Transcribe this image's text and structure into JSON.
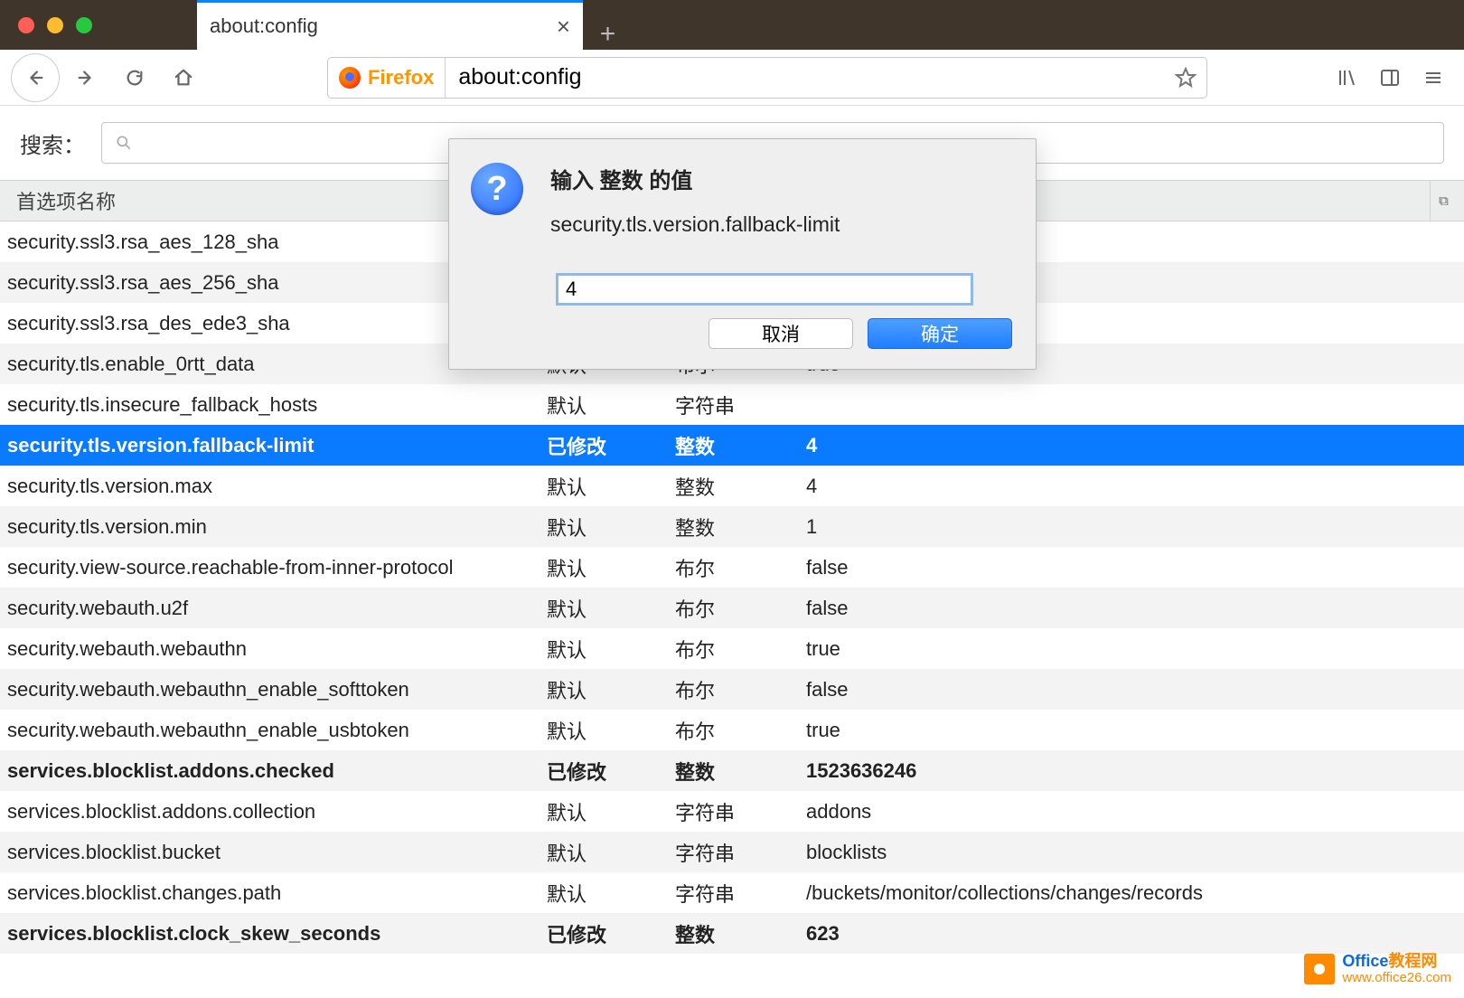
{
  "titlebar": {
    "tab_title": "about:config"
  },
  "toolbar": {
    "identity_label": "Firefox",
    "url": "about:config"
  },
  "search": {
    "label": "搜索："
  },
  "grid": {
    "header_name": "首选项名称"
  },
  "dialog": {
    "title": "输入 整数 的值",
    "message": "security.tls.version.fallback-limit",
    "input_value": "4",
    "cancel": "取消",
    "ok": "确定",
    "icon_glyph": "?"
  },
  "rows": [
    {
      "name": "security.ssl3.rsa_aes_128_sha",
      "status": "",
      "type": "",
      "value": "",
      "modified": false,
      "selected": false
    },
    {
      "name": "security.ssl3.rsa_aes_256_sha",
      "status": "",
      "type": "",
      "value": "",
      "modified": false,
      "selected": false
    },
    {
      "name": "security.ssl3.rsa_des_ede3_sha",
      "status": "",
      "type": "",
      "value": "",
      "modified": false,
      "selected": false
    },
    {
      "name": "security.tls.enable_0rtt_data",
      "status": "默认",
      "type": "布尔",
      "value": "true",
      "modified": false,
      "selected": false
    },
    {
      "name": "security.tls.insecure_fallback_hosts",
      "status": "默认",
      "type": "字符串",
      "value": "",
      "modified": false,
      "selected": false
    },
    {
      "name": "security.tls.version.fallback-limit",
      "status": "已修改",
      "type": "整数",
      "value": "4",
      "modified": true,
      "selected": true
    },
    {
      "name": "security.tls.version.max",
      "status": "默认",
      "type": "整数",
      "value": "4",
      "modified": false,
      "selected": false
    },
    {
      "name": "security.tls.version.min",
      "status": "默认",
      "type": "整数",
      "value": "1",
      "modified": false,
      "selected": false
    },
    {
      "name": "security.view-source.reachable-from-inner-protocol",
      "status": "默认",
      "type": "布尔",
      "value": "false",
      "modified": false,
      "selected": false
    },
    {
      "name": "security.webauth.u2f",
      "status": "默认",
      "type": "布尔",
      "value": "false",
      "modified": false,
      "selected": false
    },
    {
      "name": "security.webauth.webauthn",
      "status": "默认",
      "type": "布尔",
      "value": "true",
      "modified": false,
      "selected": false
    },
    {
      "name": "security.webauth.webauthn_enable_softtoken",
      "status": "默认",
      "type": "布尔",
      "value": "false",
      "modified": false,
      "selected": false
    },
    {
      "name": "security.webauth.webauthn_enable_usbtoken",
      "status": "默认",
      "type": "布尔",
      "value": "true",
      "modified": false,
      "selected": false
    },
    {
      "name": "services.blocklist.addons.checked",
      "status": "已修改",
      "type": "整数",
      "value": "1523636246",
      "modified": true,
      "selected": false
    },
    {
      "name": "services.blocklist.addons.collection",
      "status": "默认",
      "type": "字符串",
      "value": "addons",
      "modified": false,
      "selected": false
    },
    {
      "name": "services.blocklist.bucket",
      "status": "默认",
      "type": "字符串",
      "value": "blocklists",
      "modified": false,
      "selected": false
    },
    {
      "name": "services.blocklist.changes.path",
      "status": "默认",
      "type": "字符串",
      "value": "/buckets/monitor/collections/changes/records",
      "modified": false,
      "selected": false
    },
    {
      "name": "services.blocklist.clock_skew_seconds",
      "status": "已修改",
      "type": "整数",
      "value": "623",
      "modified": true,
      "selected": false
    }
  ],
  "watermark": {
    "line1a": "Office",
    "line1b": "教程网",
    "line2": "www.office26.com"
  }
}
